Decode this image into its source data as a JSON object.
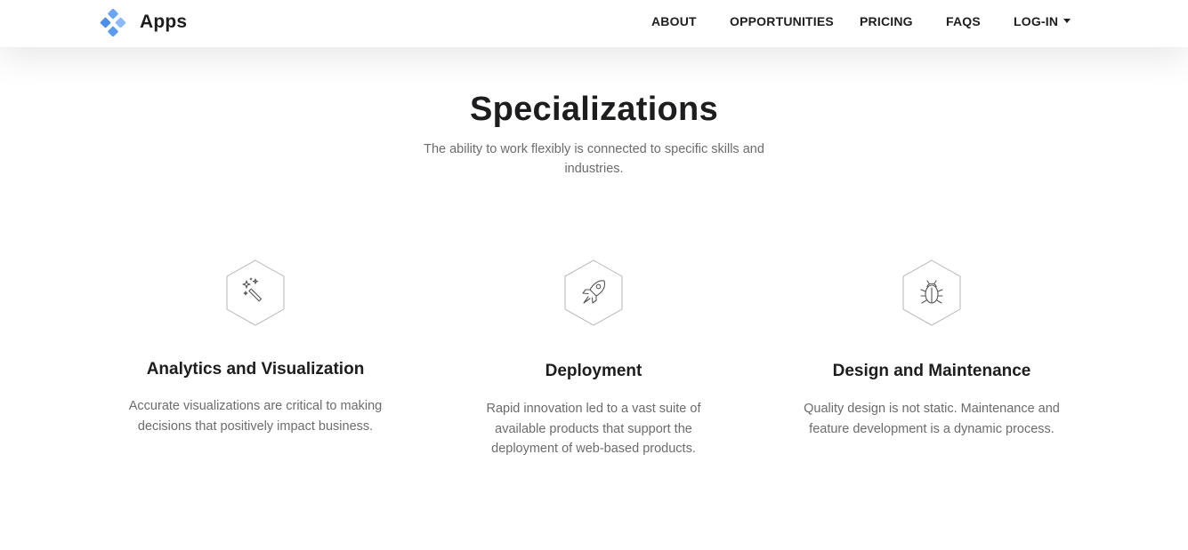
{
  "brand": {
    "name": "Apps",
    "logo_icon": "diamond-cluster-icon",
    "accent": "#5b9cf2"
  },
  "nav": {
    "about": "ABOUT",
    "opportunities": "OPPORTUNITIES",
    "pricing": "PRICING",
    "faqs": "FAQS",
    "login": "LOG-IN"
  },
  "hero": {
    "title": "Specializations",
    "subtitle": "The ability to work flexibly is connected to specific skills and industries."
  },
  "features": [
    {
      "icon": "magic-wand-icon",
      "title": "Analytics and Visualization",
      "description": "Accurate visualizations are critical to making decisions that positively impact business."
    },
    {
      "icon": "rocket-icon",
      "title": "Deployment",
      "description": "Rapid innovation led to a vast suite of available products that support the deployment of web-based products."
    },
    {
      "icon": "bug-icon",
      "title": "Design and Maintenance",
      "description": "Quality design is not static. Maintenance and feature development is a dynamic process."
    }
  ]
}
